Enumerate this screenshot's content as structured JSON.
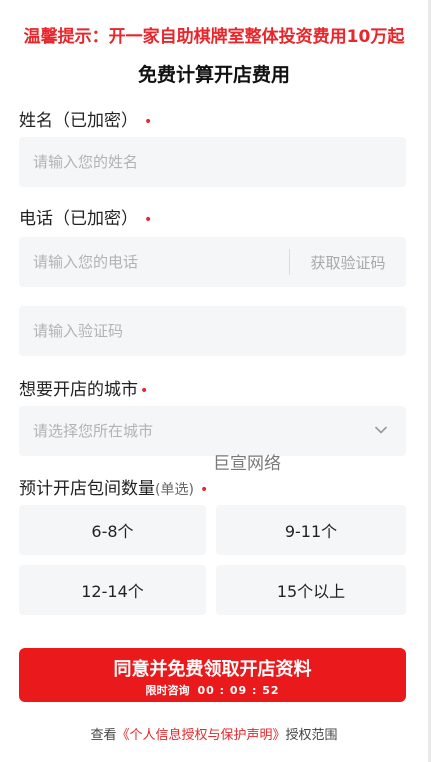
{
  "banner": {
    "warning": "温馨提示：开一家自助棋牌室整体投资费用10万起"
  },
  "form": {
    "title": "免费计算开店费用",
    "name": {
      "label": "姓名（已加密）",
      "required": "•",
      "placeholder": "请输入您的姓名"
    },
    "phone": {
      "label": "电话（已加密）",
      "required": "•",
      "placeholder": "请输入您的电话",
      "get_code": "获取验证码"
    },
    "code": {
      "placeholder": "请输入验证码"
    },
    "city": {
      "label": "想要开店的城市",
      "required": "•",
      "placeholder": "请选择您所在城市",
      "icon": "chevron-down-icon"
    },
    "rooms": {
      "label": "预计开店包间数量",
      "hint": "(单选)",
      "required": "•",
      "options": [
        "6-8个",
        "9-11个",
        "12-14个",
        "15个以上"
      ]
    },
    "submit": {
      "label": "同意并免费领取开店资料",
      "timer_label": "限时咨询",
      "timer_value": "00 : 09 : 52"
    },
    "agreement": {
      "prefix": "查看",
      "link": "《个人信息授权与保护声明》",
      "suffix": "授权范围"
    }
  },
  "watermark": "巨宣网络",
  "colors": {
    "accent": "#e8262b",
    "button": "#ea1a1c",
    "field_bg": "#f5f6f7"
  }
}
